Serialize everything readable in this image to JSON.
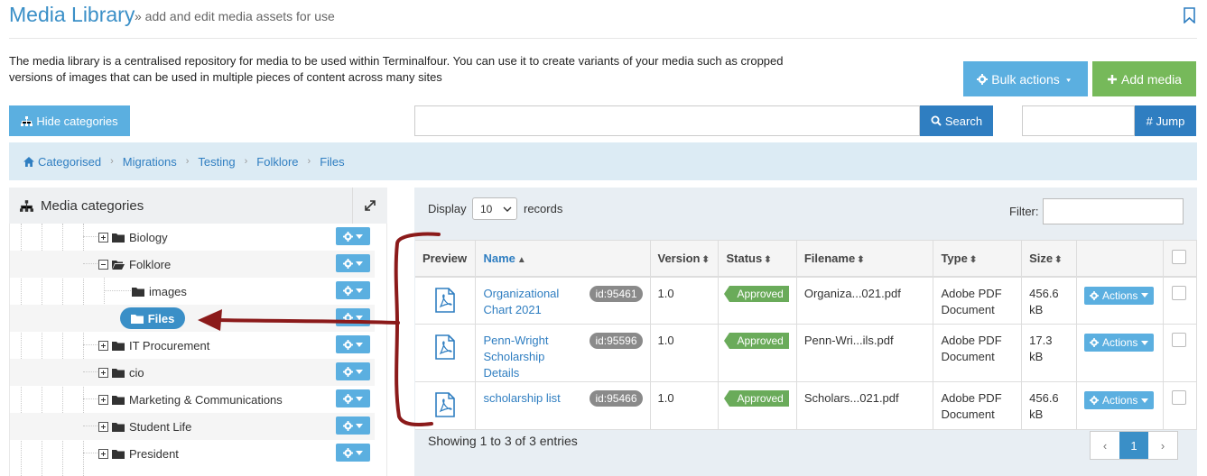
{
  "header": {
    "title": "Media Library",
    "subtitle": "» add and edit media assets for use",
    "intro": "The media library is a centralised repository for media to be used within Terminalfour. You can use it to create variants of your media such as cropped versions of images that can be used in multiple pieces of content across many sites"
  },
  "toolbar": {
    "bulk_actions": "Bulk actions",
    "add_media": "Add media",
    "hide_categories": "Hide categories",
    "search_button": "Search",
    "jump_button": "# Jump",
    "search_value": "",
    "jump_value": ""
  },
  "breadcrumb": [
    "Categorised",
    "Migrations",
    "Testing",
    "Folklore",
    "Files"
  ],
  "categories": {
    "title": "Media categories",
    "items": [
      {
        "label": "Biology"
      },
      {
        "label": "Folklore"
      },
      {
        "label": "images"
      },
      {
        "label": "Files"
      },
      {
        "label": "IT Procurement"
      },
      {
        "label": "cio"
      },
      {
        "label": "Marketing & Communications"
      },
      {
        "label": "Student Life"
      },
      {
        "label": "President"
      }
    ]
  },
  "table_controls": {
    "display_label": "Display",
    "display_value": "10",
    "records_label": "records",
    "filter_label": "Filter:",
    "filter_value": ""
  },
  "table": {
    "headers": [
      "Preview",
      "Name",
      "Version",
      "Status",
      "Filename",
      "Type",
      "Size"
    ],
    "rows": [
      {
        "name": "Organizational Chart 2021",
        "id": "id:95461",
        "version": "1.0",
        "status": "Approved",
        "filename": "Organiza...021.pdf",
        "type": "Adobe PDF Document",
        "size": "456.6 kB",
        "action": "Actions"
      },
      {
        "name": "Penn-Wright Scholarship Details",
        "id": "id:95596",
        "version": "1.0",
        "status": "Approved",
        "filename": "Penn-Wri...ils.pdf",
        "type": "Adobe PDF Document",
        "size": "17.3 kB",
        "action": "Actions"
      },
      {
        "name": "scholarship list",
        "id": "id:95466",
        "version": "1.0",
        "status": "Approved",
        "filename": "Scholars...021.pdf",
        "type": "Adobe PDF Document",
        "size": "456.6 kB",
        "action": "Actions"
      }
    ]
  },
  "footer": {
    "showing": "Showing 1 to 3 of 3 entries",
    "prev": "‹",
    "page": "1",
    "next": "›"
  },
  "colors": {
    "accent": "#3a8fc7",
    "button_blue": "#5bafe0",
    "add_green": "#76b95a",
    "approved_green": "#6aab5a",
    "annotation_red": "#8b1a1a"
  }
}
